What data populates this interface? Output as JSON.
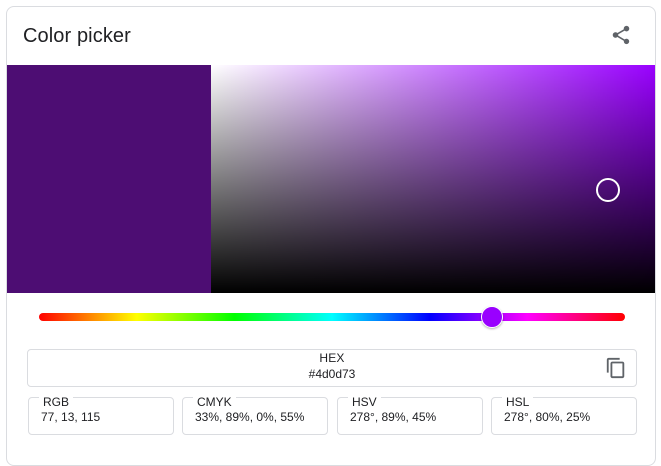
{
  "header": {
    "title": "Color picker",
    "share_icon": "share-icon"
  },
  "color": {
    "preview_hex": "#4d0d73",
    "hue_hex": "#9900ff",
    "hue_degrees": 278,
    "saturation_fraction": 0.89,
    "value_fraction": 0.45
  },
  "hex": {
    "label": "HEX",
    "value": "#4d0d73",
    "copy_icon": "copy-icon"
  },
  "formats": [
    {
      "label": "RGB",
      "value": "77, 13, 115"
    },
    {
      "label": "CMYK",
      "value": "33%, 89%, 0%, 55%"
    },
    {
      "label": "HSV",
      "value": "278°, 89%, 45%"
    },
    {
      "label": "HSL",
      "value": "278°, 80%, 25%"
    }
  ]
}
